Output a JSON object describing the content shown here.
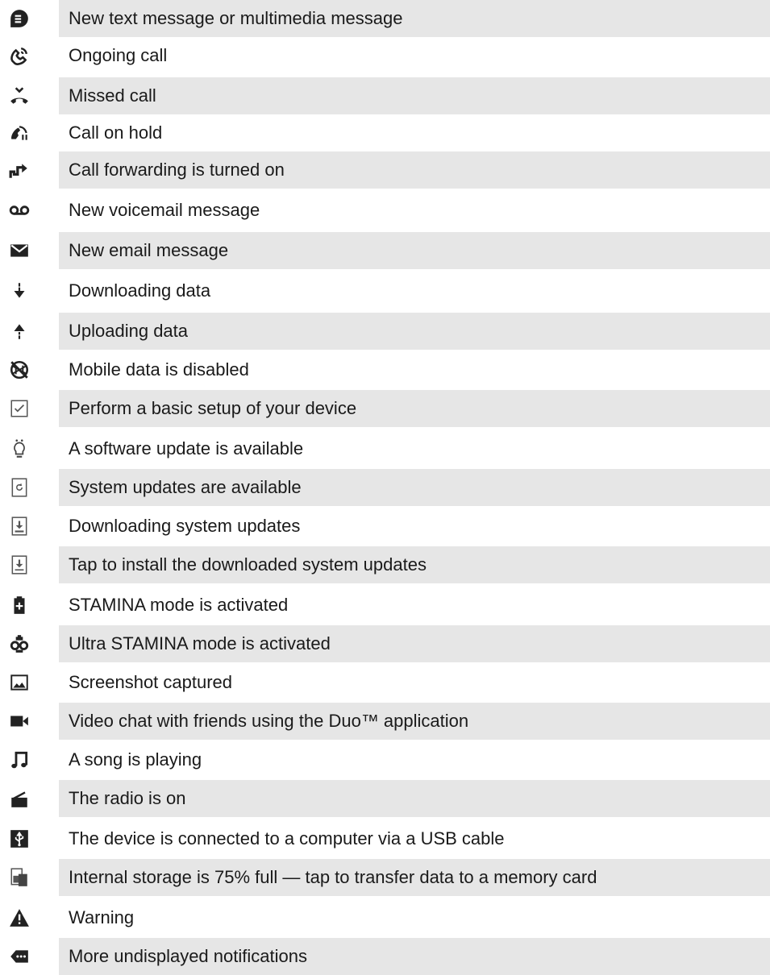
{
  "rows": [
    {
      "icon": "message-icon",
      "label": "New text message or multimedia message"
    },
    {
      "icon": "ongoing-call-icon",
      "label": "Ongoing call"
    },
    {
      "icon": "missed-call-icon",
      "label": "Missed call"
    },
    {
      "icon": "call-on-hold-icon",
      "label": "Call on hold"
    },
    {
      "icon": "call-forwarding-icon",
      "label": "Call forwarding is turned on"
    },
    {
      "icon": "voicemail-icon",
      "label": "New voicemail message"
    },
    {
      "icon": "email-icon",
      "label": "New email message"
    },
    {
      "icon": "download-icon",
      "label": "Downloading data"
    },
    {
      "icon": "upload-icon",
      "label": "Uploading data"
    },
    {
      "icon": "mobile-data-disabled-icon",
      "label": "Mobile data is disabled"
    },
    {
      "icon": "setup-checkbox-icon",
      "label": "Perform a basic setup of your device"
    },
    {
      "icon": "software-update-icon",
      "label": "A software update is available"
    },
    {
      "icon": "system-update-icon",
      "label": "System updates are available"
    },
    {
      "icon": "system-update-downloading-icon",
      "label": "Downloading system updates"
    },
    {
      "icon": "install-update-icon",
      "label": "Tap to install the downloaded system updates"
    },
    {
      "icon": "stamina-battery-icon",
      "label": "STAMINA mode is activated"
    },
    {
      "icon": "ultra-stamina-icon",
      "label": "Ultra STAMINA mode is activated"
    },
    {
      "icon": "screenshot-icon",
      "label": "Screenshot captured"
    },
    {
      "icon": "video-camera-icon",
      "label": "Video chat with friends using the Duo™ application"
    },
    {
      "icon": "music-note-icon",
      "label": "A song is playing"
    },
    {
      "icon": "radio-icon",
      "label": "The radio is on"
    },
    {
      "icon": "usb-icon",
      "label": "The device is connected to a computer via a USB cable"
    },
    {
      "icon": "storage-full-icon",
      "label": "Internal storage is 75% full — tap to transfer data to a memory card"
    },
    {
      "icon": "warning-icon",
      "label": "Warning"
    },
    {
      "icon": "more-notifications-icon",
      "label": "More undisplayed notifications"
    }
  ]
}
